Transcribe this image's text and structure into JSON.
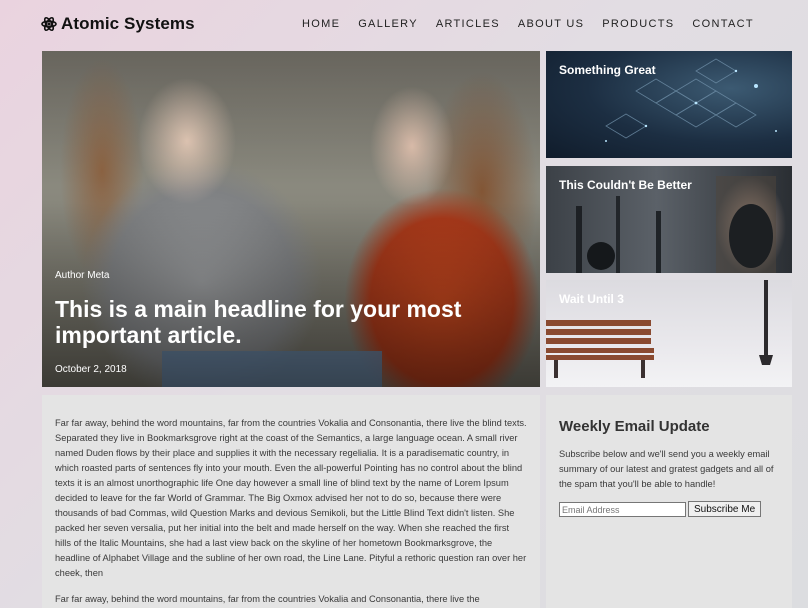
{
  "site": {
    "logo_text": "Atomic Systems",
    "logo_icon": "atom-icon"
  },
  "nav": {
    "items": [
      "HOME",
      "GALLERY",
      "ARTICLES",
      "ABOUT US",
      "PRODUCTS",
      "CONTACT"
    ]
  },
  "hero": {
    "meta": "Author Meta",
    "title": "This is a main headline for your most important article.",
    "date": "October 2, 2018"
  },
  "cards": [
    {
      "title": "Something Great"
    },
    {
      "title": "This Couldn't Be Better"
    },
    {
      "title": "Wait Until 3"
    }
  ],
  "article": {
    "paragraphs": [
      "Far far away, behind the word mountains, far from the countries Vokalia and Consonantia, there live the blind texts. Separated they live in Bookmarksgrove right at the coast of the Semantics, a large language ocean. A small river named Duden flows by their place and supplies it with the necessary regelialia. It is a paradisematic country, in which roasted parts of sentences fly into your mouth. Even the all-powerful Pointing has no control about the blind texts it is an almost unorthographic life One day however a small line of blind text by the name of Lorem Ipsum decided to leave for the far World of Grammar. The Big Oxmox advised her not to do so, because there were thousands of bad Commas, wild Question Marks and devious Semikoli, but the Little Blind Text didn't listen. She packed her seven versalia, put her initial into the belt and made herself on the way. When she reached the first hills of the Italic Mountains, she had a last view back on the skyline of her hometown Bookmarksgrove, the headline of Alphabet Village and the subline of her own road, the Line Lane. Pityful a rethoric question ran over her cheek, then",
      "Far far away, behind the word mountains, far from the countries Vokalia and Consonantia, there live the"
    ]
  },
  "newsletter": {
    "title": "Weekly Email Update",
    "description": "Subscribe below and we'll send you a weekly email summary of our latest and gratest gadgets and all of the spam that you'll be able to handle!",
    "input_placeholder": "Email Address",
    "button_label": "Subscribe Me"
  }
}
